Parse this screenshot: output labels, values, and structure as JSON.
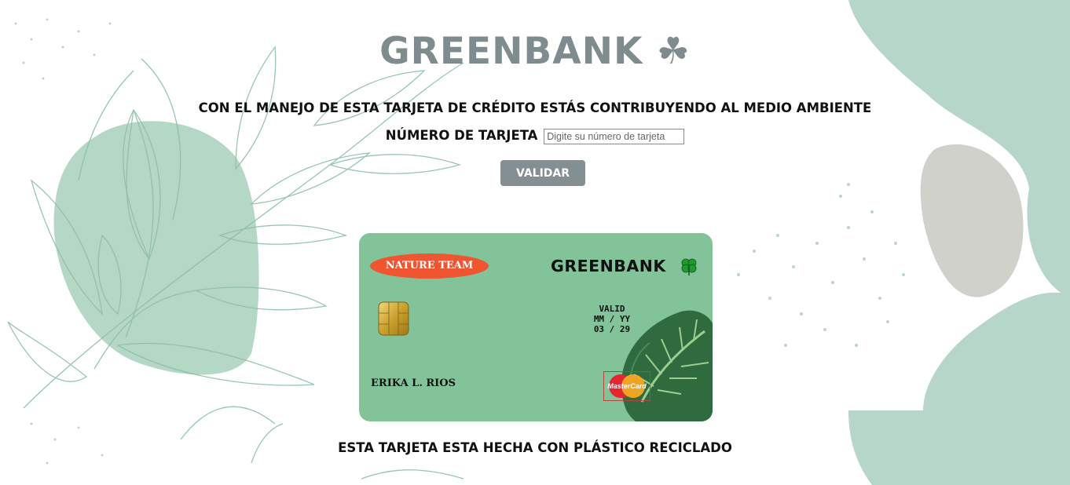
{
  "header": {
    "title": "GREENBANK",
    "title_icon": "shamrock-icon",
    "subtitle": "CON EL MANEJO DE ESTA TARJETA DE CRÉDITO ESTÁS CONTRIBUYENDO AL MEDIO AMBIENTE"
  },
  "form": {
    "card_number_label": "NÚMERO DE TARJETA",
    "card_number_value": "",
    "card_number_placeholder": "Digite su número de tarjeta",
    "validate_button": "VALIDAR"
  },
  "card": {
    "badge": "NATURE TEAM",
    "brand": "GREENBANK",
    "brand_icon": "four-leaf-clover-icon",
    "valid_label": "VALID",
    "valid_format": "MM / YY",
    "valid_date": "03 / 29",
    "holder_name": "ERIKA L. RIOS",
    "network_logo_text": "MasterCard",
    "background_color": "#83c39a",
    "badge_color": "#ee5530"
  },
  "footer": {
    "text": "ESTA TARJETA ESTA HECHA CON PLÁSTICO RECICLADO"
  },
  "colors": {
    "title": "#7f8c8f",
    "button": "#848f93",
    "accent_green": "#b8d8cc"
  }
}
